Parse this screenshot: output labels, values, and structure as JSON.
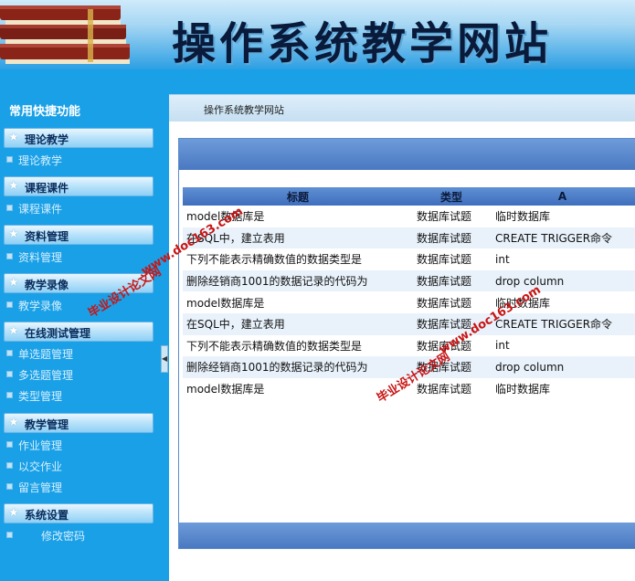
{
  "header": {
    "title": "操作系统教学网站"
  },
  "sidebar": {
    "heading": "常用快捷功能",
    "groups": [
      {
        "label": "理论教学",
        "items": [
          "理论教学"
        ]
      },
      {
        "label": "课程课件",
        "items": [
          "课程课件"
        ]
      },
      {
        "label": "资料管理",
        "items": [
          "资料管理"
        ]
      },
      {
        "label": "教学录像",
        "items": [
          "教学录像"
        ]
      },
      {
        "label": "在线测试管理",
        "items": [
          "单选题管理",
          "多选题管理",
          "类型管理"
        ]
      },
      {
        "label": "教学管理",
        "items": [
          "作业管理",
          "以交作业",
          "留言管理"
        ]
      },
      {
        "label": "系统设置",
        "items": [
          "修改密码"
        ]
      }
    ]
  },
  "breadcrumb": "操作系统教学网站",
  "table": {
    "columns": [
      "标题",
      "类型",
      "A"
    ],
    "rows": [
      [
        "model数据库是",
        "数据库试题",
        "临时数据库"
      ],
      [
        "在SQL中，建立表用",
        "数据库试题",
        "CREATE TRIGGER命令"
      ],
      [
        "下列不能表示精确数值的数据类型是",
        "数据库试题",
        "int"
      ],
      [
        "删除经销商1001的数据记录的代码为",
        "数据库试题",
        "drop column"
      ],
      [
        "model数据库是",
        "数据库试题",
        "临时数据库"
      ],
      [
        "在SQL中，建立表用",
        "数据库试题",
        "CREATE TRIGGER命令"
      ],
      [
        "下列不能表示精确数值的数据类型是",
        "数据库试题",
        "int"
      ],
      [
        "删除经销商1001的数据记录的代码为",
        "数据库试题",
        "drop column"
      ],
      [
        "model数据库是",
        "数据库试题",
        "临时数据库"
      ]
    ]
  },
  "watermarks": {
    "site_name": "毕业设计论文网",
    "url": "www.doc163.com"
  },
  "icons": {
    "group_icon": "star-icon",
    "item_icon": "square-bullet-icon",
    "collapse_icon": "arrow-left-icon"
  }
}
